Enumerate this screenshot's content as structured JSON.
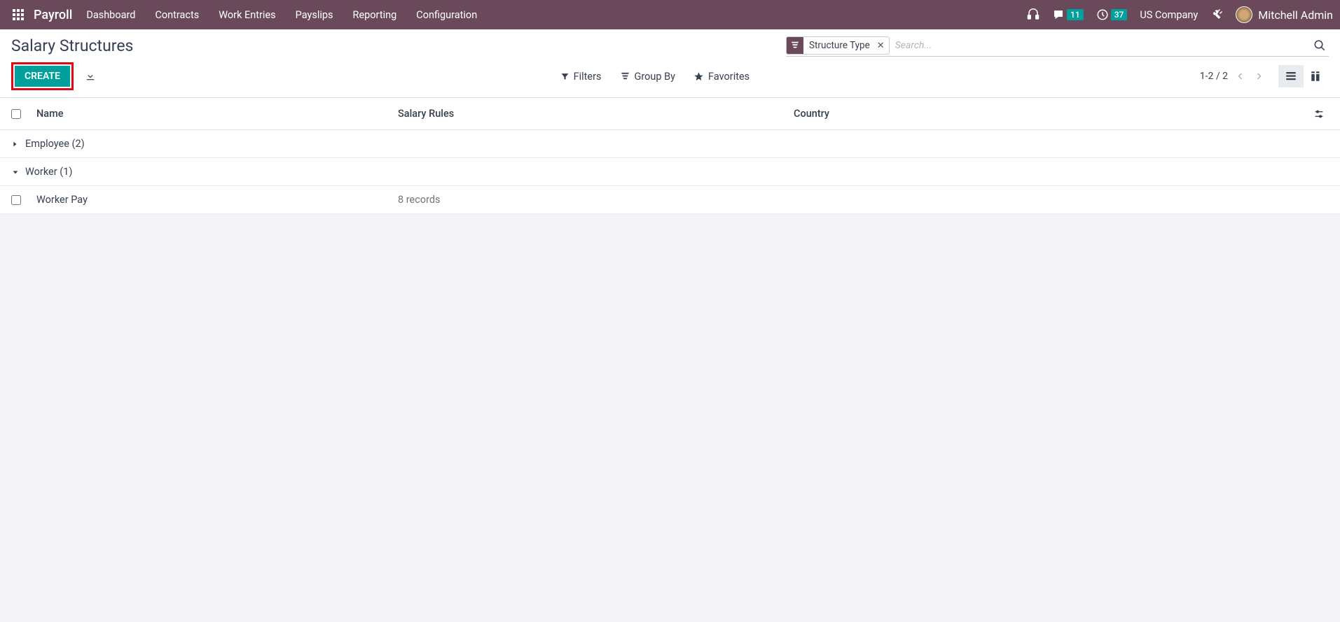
{
  "navbar": {
    "brand": "Payroll",
    "menu": [
      "Dashboard",
      "Contracts",
      "Work Entries",
      "Payslips",
      "Reporting",
      "Configuration"
    ],
    "messages_badge": "11",
    "activities_badge": "37",
    "company": "US Company",
    "user": "Mitchell Admin"
  },
  "page": {
    "title": "Salary Structures",
    "create_label": "Create"
  },
  "search": {
    "facet_label": "Structure Type",
    "placeholder": "Search..."
  },
  "toolbar": {
    "filters": "Filters",
    "group_by": "Group By",
    "favorites": "Favorites"
  },
  "pager": {
    "range": "1-2 / 2"
  },
  "columns": {
    "name": "Name",
    "rules": "Salary Rules",
    "country": "Country"
  },
  "groups": [
    {
      "label": "Employee",
      "count": "(2)",
      "expanded": false
    },
    {
      "label": "Worker",
      "count": "(1)",
      "expanded": true
    }
  ],
  "rows": [
    {
      "name": "Worker Pay",
      "rules": "8 records",
      "country": ""
    }
  ]
}
